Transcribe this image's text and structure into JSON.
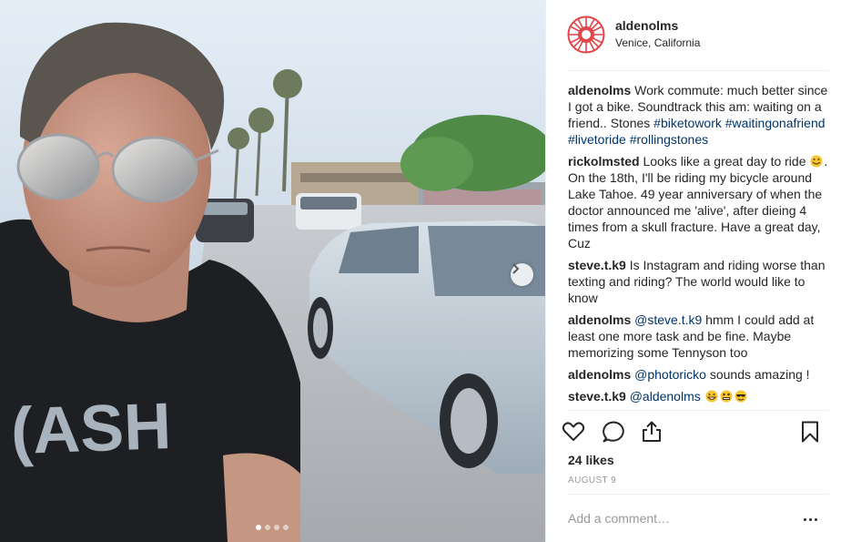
{
  "post": {
    "username": "aldenolms",
    "location": "Venice, California",
    "carousel": {
      "slides": 4,
      "active_index": 0
    },
    "likes": "24 likes",
    "date": "AUGUST 9",
    "comment_placeholder": "Add a comment…"
  },
  "comments": [
    {
      "user": "aldenolms",
      "parts": [
        {
          "text": "Work commute: much better since I got a bike. Soundtrack this am: waiting on a friend.. Stones "
        },
        {
          "tag": "#biketowork"
        },
        {
          "text": " "
        },
        {
          "tag": "#waitingonafriend"
        },
        {
          "text": " "
        },
        {
          "tag": "#livetoride"
        },
        {
          "text": " "
        },
        {
          "tag": "#rollingstones"
        }
      ]
    },
    {
      "user": "rickolmsted",
      "parts": [
        {
          "text": "Looks like a great day to ride "
        },
        {
          "emoji": "smile"
        },
        {
          "text": ". On the 18th, I'll be riding my bicycle around Lake Tahoe. 49 year anniversary of when the doctor announced me 'alive', after dieing 4 times from a skull fracture. Have a great day, Cuz"
        }
      ]
    },
    {
      "user": "steve.t.k9",
      "parts": [
        {
          "text": "Is Instagram and riding worse than texting and riding? The world would like to know"
        }
      ]
    },
    {
      "user": "aldenolms",
      "parts": [
        {
          "tag": "@steve.t.k9"
        },
        {
          "text": " hmm I could add at least one more task and be fine. Maybe memorizing some Tennyson too"
        }
      ]
    },
    {
      "user": "aldenolms",
      "parts": [
        {
          "tag": "@photoricko"
        },
        {
          "text": " sounds amazing !"
        }
      ]
    },
    {
      "user": "steve.t.k9",
      "parts": [
        {
          "tag": "@aldenolms"
        },
        {
          "text": " "
        },
        {
          "emoji": "grin"
        },
        {
          "emoji": "grimace"
        },
        {
          "emoji": "sunglasses"
        }
      ]
    }
  ],
  "icons": [
    "heart-icon",
    "comment-icon",
    "share-icon",
    "bookmark-icon",
    "chevron-right-icon",
    "more-icon"
  ],
  "colors": {
    "link": "#003569",
    "text": "#262626",
    "muted": "#999999",
    "divider": "#efefef",
    "avatar_red": "#e0464a"
  }
}
